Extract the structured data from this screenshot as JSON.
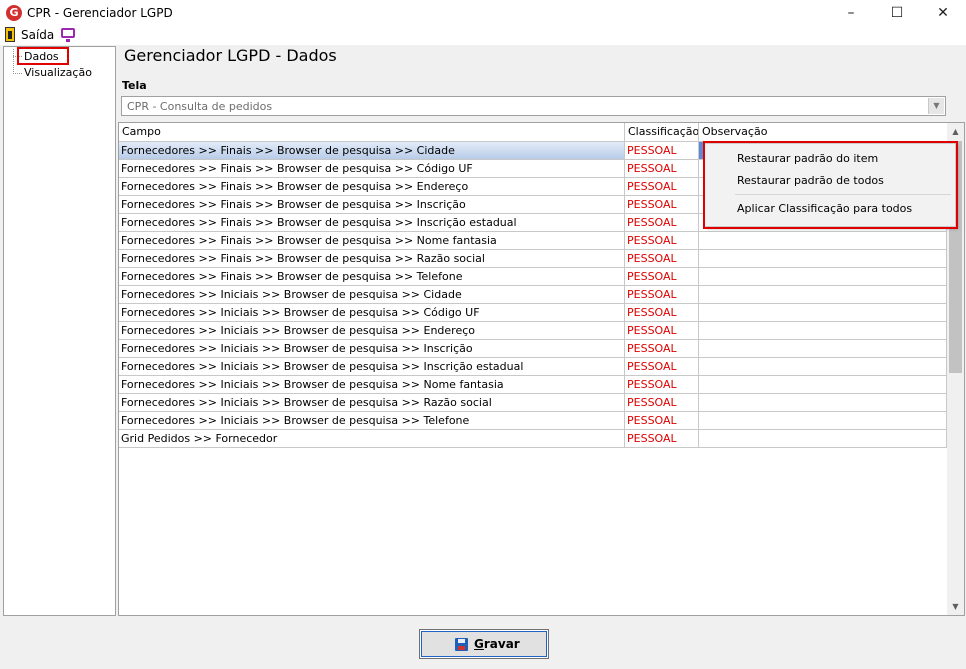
{
  "window": {
    "title": "CPR - Gerenciador LGPD",
    "logo_letter": "G",
    "minimize": "–",
    "maximize": "☐",
    "close": "✕"
  },
  "menu": {
    "exit_label": "Saída"
  },
  "tree": {
    "items": [
      "Dados",
      "Visualização"
    ]
  },
  "page": {
    "title": "Gerenciador LGPD - Dados",
    "tela_label": "Tela",
    "tela_value": "CPR - Consulta de pedidos"
  },
  "grid": {
    "columns": [
      "Campo",
      "Classificação",
      "Observação"
    ],
    "rows": [
      {
        "campo": "Fornecedores >> Finais >> Browser de pesquisa >> Cidade",
        "classificacao": "PESSOAL",
        "observacao": ""
      },
      {
        "campo": "Fornecedores >> Finais >> Browser de pesquisa >> Código UF",
        "classificacao": "PESSOAL",
        "observacao": ""
      },
      {
        "campo": "Fornecedores >> Finais >> Browser de pesquisa >> Endereço",
        "classificacao": "PESSOAL",
        "observacao": ""
      },
      {
        "campo": "Fornecedores >> Finais >> Browser de pesquisa >> Inscrição",
        "classificacao": "PESSOAL",
        "observacao": ""
      },
      {
        "campo": "Fornecedores >> Finais >> Browser de pesquisa >> Inscrição estadual",
        "classificacao": "PESSOAL",
        "observacao": ""
      },
      {
        "campo": "Fornecedores >> Finais >> Browser de pesquisa >> Nome fantasia",
        "classificacao": "PESSOAL",
        "observacao": ""
      },
      {
        "campo": "Fornecedores >> Finais >> Browser de pesquisa >> Razão social",
        "classificacao": "PESSOAL",
        "observacao": ""
      },
      {
        "campo": "Fornecedores >> Finais >> Browser de pesquisa >> Telefone",
        "classificacao": "PESSOAL",
        "observacao": ""
      },
      {
        "campo": "Fornecedores >> Iniciais >> Browser de pesquisa >> Cidade",
        "classificacao": "PESSOAL",
        "observacao": ""
      },
      {
        "campo": "Fornecedores >> Iniciais >> Browser de pesquisa >> Código UF",
        "classificacao": "PESSOAL",
        "observacao": ""
      },
      {
        "campo": "Fornecedores >> Iniciais >> Browser de pesquisa >> Endereço",
        "classificacao": "PESSOAL",
        "observacao": ""
      },
      {
        "campo": "Fornecedores >> Iniciais >> Browser de pesquisa >> Inscrição",
        "classificacao": "PESSOAL",
        "observacao": ""
      },
      {
        "campo": "Fornecedores >> Iniciais >> Browser de pesquisa >> Inscrição estadual",
        "classificacao": "PESSOAL",
        "observacao": ""
      },
      {
        "campo": "Fornecedores >> Iniciais >> Browser de pesquisa >> Nome fantasia",
        "classificacao": "PESSOAL",
        "observacao": ""
      },
      {
        "campo": "Fornecedores >> Iniciais >> Browser de pesquisa >> Razão social",
        "classificacao": "PESSOAL",
        "observacao": ""
      },
      {
        "campo": "Fornecedores >> Iniciais >> Browser de pesquisa >> Telefone",
        "classificacao": "PESSOAL",
        "observacao": ""
      },
      {
        "campo": "Grid Pedidos >> Fornecedor",
        "classificacao": "PESSOAL",
        "observacao": ""
      }
    ]
  },
  "context_menu": {
    "items": [
      "Restaurar padrão do item",
      "Restaurar padrão de todos",
      "Aplicar Classificação para todos"
    ]
  },
  "save_button": {
    "label_mnemonic": "G",
    "label_rest": "ravar"
  },
  "colors": {
    "classification_text": "#e00000",
    "selection": "#5b8ad6",
    "annotation": "#e00000"
  }
}
